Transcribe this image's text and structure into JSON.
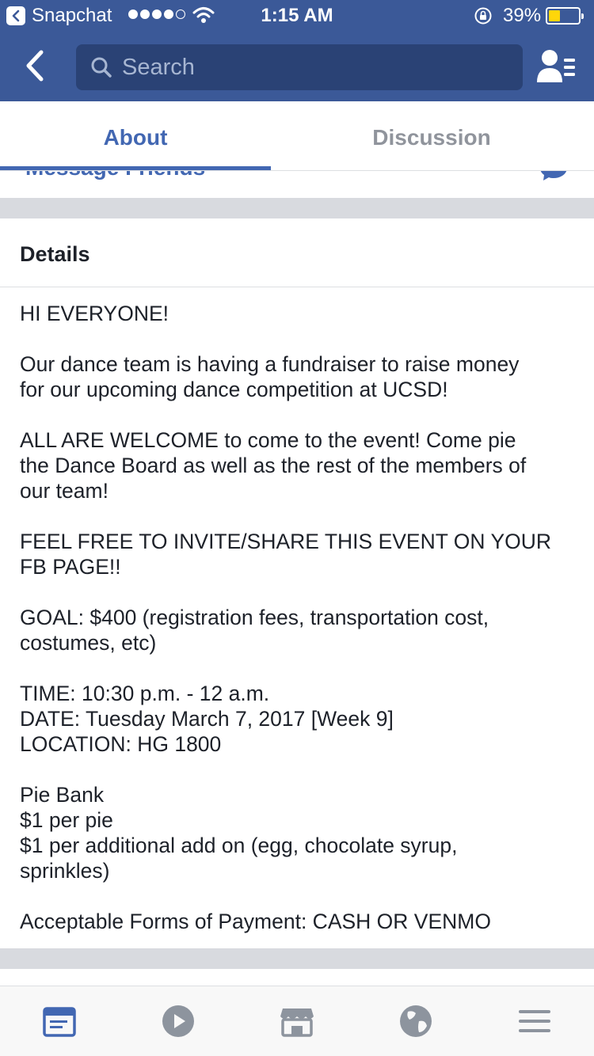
{
  "status_bar": {
    "back_app": "Snapchat",
    "time": "1:15 AM",
    "battery": "39%",
    "battery_level": 0.39,
    "signal_bars": 4,
    "signal_total": 5
  },
  "nav": {
    "search_placeholder": "Search"
  },
  "tabs": {
    "about": "About",
    "discussion": "Discussion",
    "active": "About"
  },
  "peek_row": {
    "label": "Message Friends"
  },
  "details": {
    "heading": "Details",
    "lines": [
      "HI EVERYONE!",
      "",
      "Our dance team is having a fundraiser to raise money",
      "for our upcoming dance competition at UCSD!",
      "",
      "ALL ARE WELCOME to come to the event! Come pie",
      "the Dance Board as well as the rest of the members of",
      "our team!",
      "",
      "FEEL FREE TO INVITE/SHARE THIS EVENT ON YOUR",
      "FB PAGE!!",
      "",
      "GOAL: $400 (registration fees, transportation cost,",
      "costumes, etc)",
      "",
      "TIME: 10:30 p.m. - 12 a.m.",
      "DATE: Tuesday March 7, 2017 [Week 9]",
      "LOCATION: HG 1800",
      "",
      "Pie Bank",
      "$1 per pie",
      "$1 per additional add on (egg, chocolate syrup,",
      "sprinkles)",
      "",
      "Acceptable Forms of Payment: CASH OR VENMO"
    ]
  },
  "tab_bar": {
    "items": [
      "news-feed-icon",
      "video-icon",
      "marketplace-icon",
      "notifications-globe-icon",
      "menu-icon"
    ],
    "active": "news-feed-icon",
    "colors": {
      "active": "#4267b2",
      "inactive": "#8d949e"
    }
  },
  "colors": {
    "brand": "#3b5998",
    "search_bg": "#2a4275",
    "tab_active": "#4267b2",
    "tab_inactive": "#90949c",
    "battery_fill": "#ffd60a"
  }
}
